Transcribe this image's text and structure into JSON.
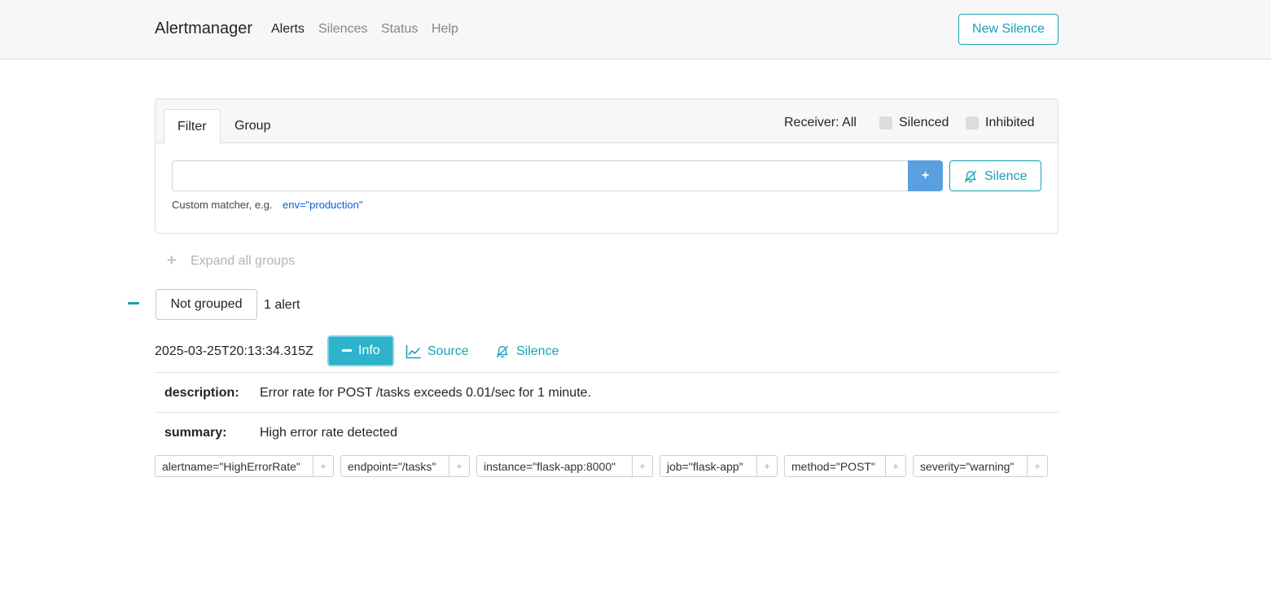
{
  "navbar": {
    "brand": "Alertmanager",
    "links": [
      "Alerts",
      "Silences",
      "Status",
      "Help"
    ],
    "new_silence_label": "New Silence"
  },
  "filter": {
    "tabs": [
      "Filter",
      "Group"
    ],
    "receiver_label": "Receiver: All",
    "silenced_label": "Silenced",
    "inhibited_label": "Inhibited",
    "input_value": "",
    "add_label": "+",
    "silence_label": "Silence",
    "hint_prefix": "Custom matcher, e.g.",
    "hint_example": "env=\"production\""
  },
  "groups": {
    "expand_all_label": "Expand all groups",
    "group_name": "Not grouped",
    "alert_count": "1 alert"
  },
  "alert": {
    "timestamp": "2025-03-25T20:13:34.315Z",
    "info_label": "Info",
    "source_label": "Source",
    "silence_label": "Silence",
    "annotations": [
      {
        "key": "description:",
        "value": "Error rate for POST /tasks exceeds 0.01/sec for 1 minute."
      },
      {
        "key": "summary:",
        "value": "High error rate detected"
      }
    ],
    "labels": [
      "alertname=\"HighErrorRate\"",
      "endpoint=\"/tasks\"",
      "instance=\"flask-app:8000\"",
      "job=\"flask-app\"",
      "method=\"POST\"",
      "severity=\"warning\""
    ],
    "label_add": "+"
  },
  "colors": {
    "accent": "#17a2b8",
    "primary": "#5b9fe0",
    "navbar_bg": "#f7f7f7"
  }
}
